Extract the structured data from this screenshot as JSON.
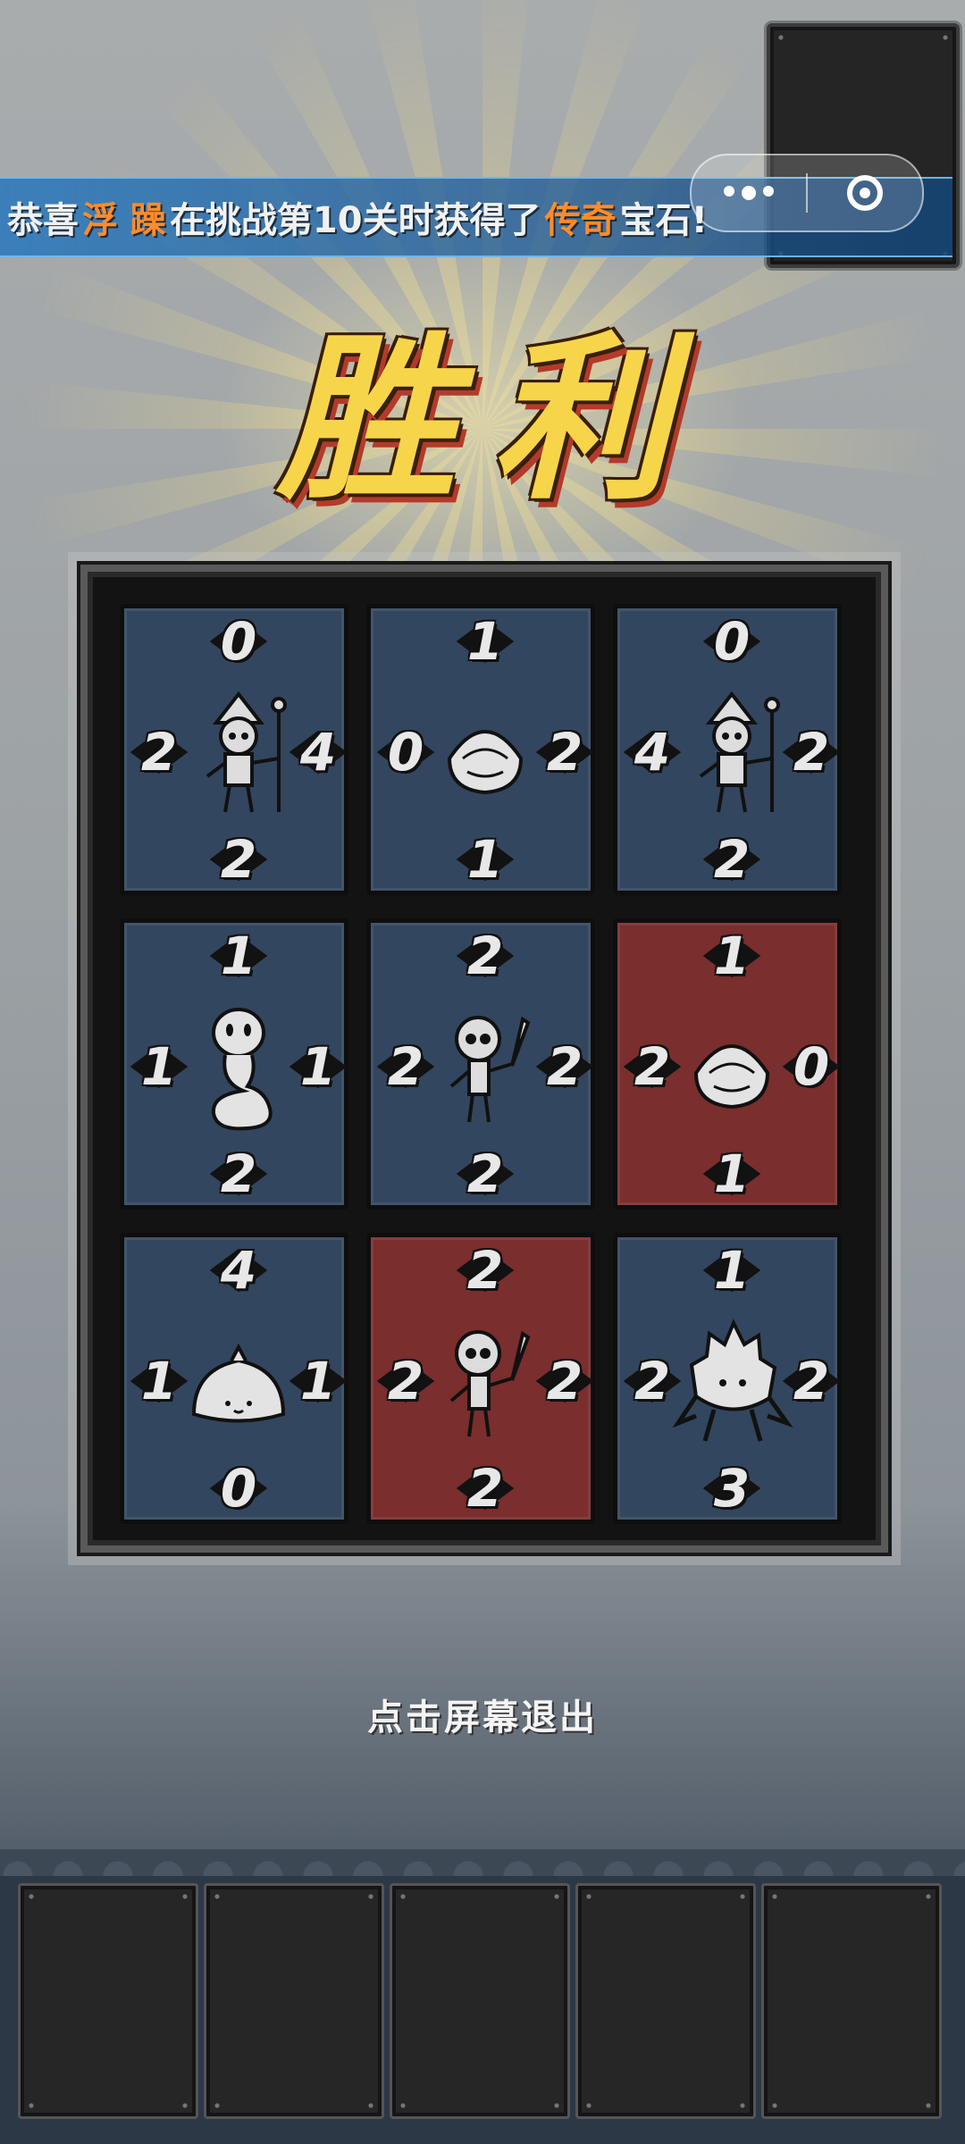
{
  "banner": {
    "prefix": "恭喜",
    "player": "浮 躁",
    "middle": "在挑战第10关时获得了",
    "rarity": "传奇",
    "suffix": "宝石!"
  },
  "title": "胜利",
  "exit_hint": "点击屏幕退出",
  "board": {
    "cells": [
      {
        "color": "blue",
        "creature": "wizard-icon",
        "top": "0",
        "right": "4",
        "bottom": "2",
        "left": "2"
      },
      {
        "color": "blue",
        "creature": "egg-icon",
        "top": "1",
        "right": "2",
        "bottom": "1",
        "left": "0"
      },
      {
        "color": "blue",
        "creature": "wizard-icon",
        "top": "0",
        "right": "2",
        "bottom": "2",
        "left": "4"
      },
      {
        "color": "blue",
        "creature": "ghost-icon",
        "top": "1",
        "right": "1",
        "bottom": "2",
        "left": "1"
      },
      {
        "color": "blue",
        "creature": "skeleton-icon",
        "top": "2",
        "right": "2",
        "bottom": "2",
        "left": "2"
      },
      {
        "color": "red",
        "creature": "egg-icon",
        "top": "1",
        "right": "0",
        "bottom": "1",
        "left": "2"
      },
      {
        "color": "blue",
        "creature": "dumpling-icon",
        "top": "4",
        "right": "1",
        "bottom": "0",
        "left": "1"
      },
      {
        "color": "red",
        "creature": "skeleton-icon",
        "top": "2",
        "right": "2",
        "bottom": "2",
        "left": "2"
      },
      {
        "color": "blue",
        "creature": "spiky-beast-icon",
        "top": "1",
        "right": "2",
        "bottom": "3",
        "left": "2"
      }
    ]
  },
  "colors": {
    "blue": "#33465f",
    "red": "#7a2e2d",
    "title": "#f7d54a",
    "highlight": "#ff8c2a"
  }
}
